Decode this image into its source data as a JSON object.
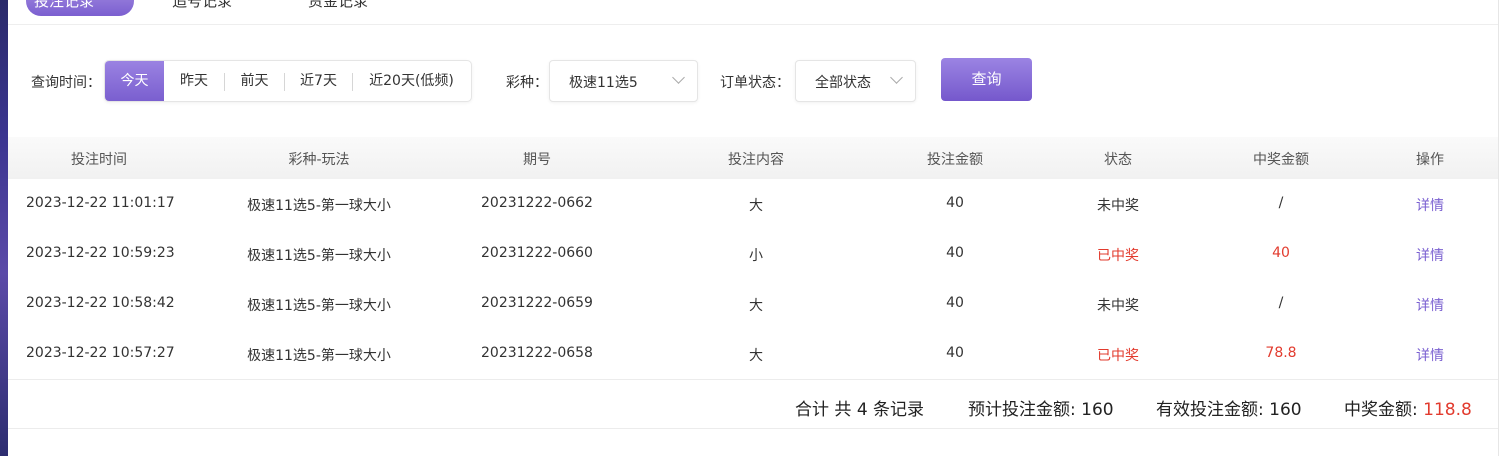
{
  "tabs": [
    "投注记录",
    "追号记录",
    "资金记录"
  ],
  "filters": {
    "time_label": "查询时间：",
    "time_options": [
      "今天",
      "昨天",
      "前天",
      "近7天",
      "近20天(低频)"
    ],
    "time_selected": "今天",
    "lottery_label": "彩种：",
    "lottery_value": "极速11选5",
    "status_label": "订单状态：",
    "status_value": "全部状态",
    "query_label": "查询"
  },
  "table": {
    "headers": [
      "投注时间",
      "彩种-玩法",
      "期号",
      "投注内容",
      "投注金额",
      "状态",
      "中奖金额",
      "操作"
    ],
    "rows": [
      [
        "2023-12-22 11:01:17",
        "极速11选5-第一球大小",
        "20231222-0662",
        "大",
        "40",
        "未中奖",
        "/",
        "详情"
      ],
      [
        "2023-12-22 10:59:23",
        "极速11选5-第一球大小",
        "20231222-0660",
        "小",
        "40",
        "已中奖",
        "40",
        "详情"
      ],
      [
        "2023-12-22 10:58:42",
        "极速11选5-第一球大小",
        "20231222-0659",
        "大",
        "40",
        "未中奖",
        "/",
        "详情"
      ],
      [
        "2023-12-22 10:57:27",
        "极速11选5-第一球大小",
        "20231222-0658",
        "大",
        "40",
        "已中奖",
        "78.8",
        "详情"
      ]
    ]
  },
  "summary": {
    "total_prefix": "合计 共",
    "total_count": "4",
    "total_suffix": "条记录",
    "expected_label": "预计投注金额:",
    "expected_value": "160",
    "valid_label": "有效投注金额:",
    "valid_value": "160",
    "win_label": "中奖金额:",
    "win_value": "118.8"
  },
  "colors": {
    "accent": "#7b61d1",
    "win_red": "#e23b2e"
  }
}
